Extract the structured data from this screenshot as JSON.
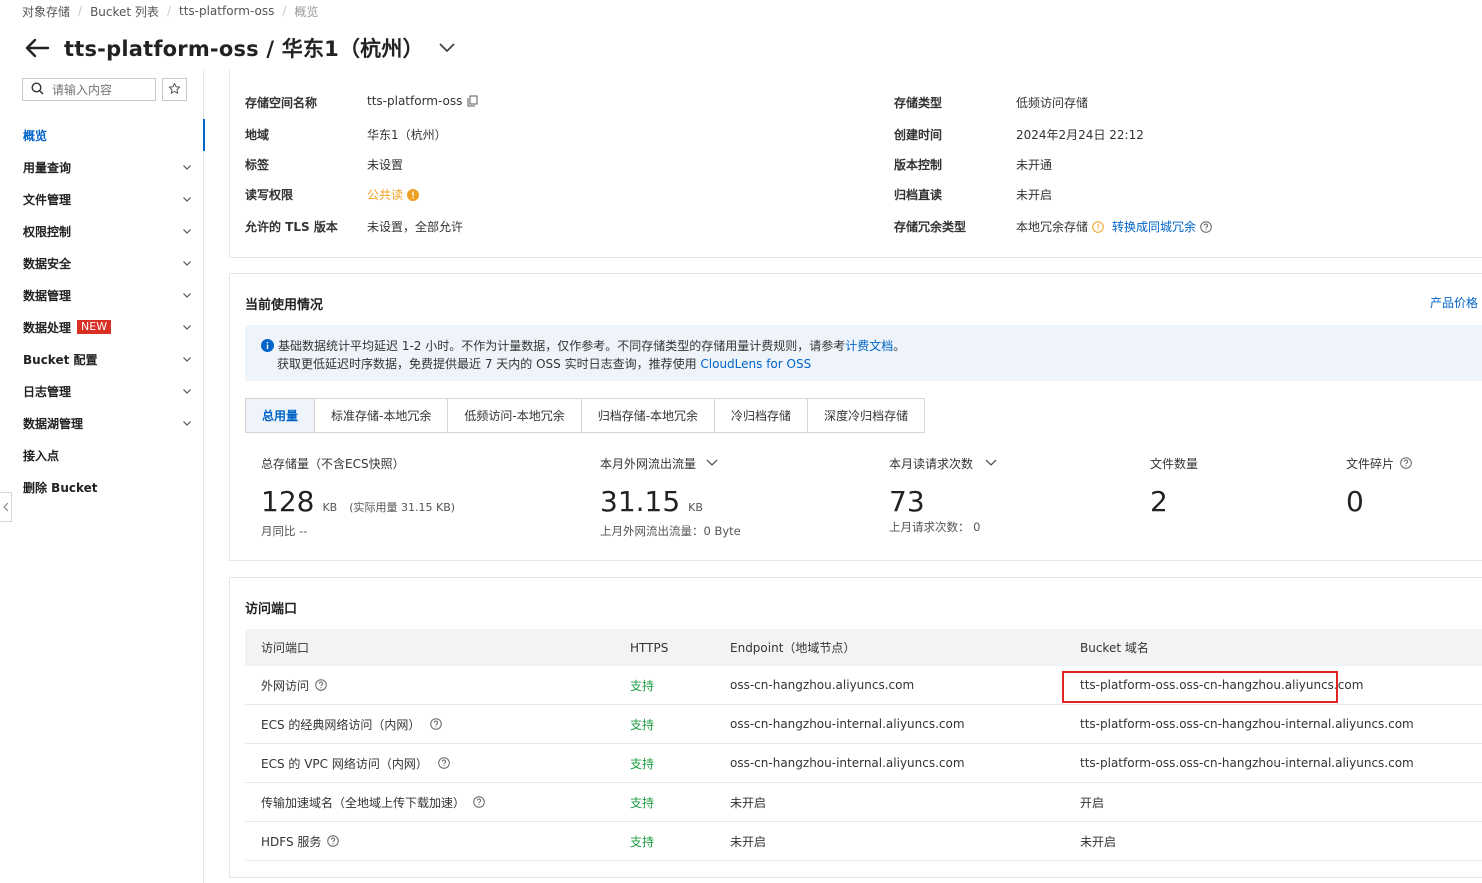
{
  "breadcrumb": [
    "对象存储",
    "Bucket 列表",
    "tts-platform-oss",
    "概览"
  ],
  "header": {
    "title": "tts-platform-oss / 华东1（杭州）"
  },
  "sidebar": {
    "search_placeholder": "请输入内容",
    "items": [
      {
        "label": "概览",
        "active": true
      },
      {
        "label": "用量查询"
      },
      {
        "label": "文件管理"
      },
      {
        "label": "权限控制"
      },
      {
        "label": "数据安全"
      },
      {
        "label": "数据管理"
      },
      {
        "label": "数据处理",
        "badge": "NEW"
      },
      {
        "label": "Bucket 配置"
      },
      {
        "label": "日志管理"
      },
      {
        "label": "数据湖管理"
      },
      {
        "label": "接入点"
      },
      {
        "label": "删除 Bucket"
      }
    ]
  },
  "info": {
    "bucket_name_label": "存储空间名称",
    "bucket_name": "tts-platform-oss",
    "region_label": "地域",
    "region": "华东1（杭州）",
    "tags_label": "标签",
    "tags": "未设置",
    "acl_label": "读写权限",
    "acl": "公共读",
    "tls_label": "允许的 TLS 版本",
    "tls": "未设置，全部允许",
    "storage_class_label": "存储类型",
    "storage_class": "低频访问存储",
    "created_label": "创建时间",
    "created": "2024年2月24日 22:12",
    "versioning_label": "版本控制",
    "versioning": "未开通",
    "archive_label": "归档直读",
    "archive": "未开启",
    "redundancy_label": "存储冗余类型",
    "redundancy": "本地冗余存储",
    "redundancy_link": "转换成同城冗余"
  },
  "usage": {
    "title": "当前使用情况",
    "price_link": "产品价格",
    "notice_line1_a": "基础数据统计平均延迟 1-2 小时。不作为计量数据，仅作参考。不同存储类型的存储用量计费规则，请参考",
    "notice_link": "计费文档",
    "notice_line1_b": "。",
    "notice_line2_a": "获取更低延迟时序数据，免费提供最近 7 天内的 OSS 实时日志查询，推荐使用 ",
    "notice_line2_link": "CloudLens for OSS",
    "tabs": [
      "总用量",
      "标准存储-本地冗余",
      "低频访问-本地冗余",
      "归档存储-本地冗余",
      "冷归档存储",
      "深度冷归档存储"
    ],
    "metrics": {
      "storage_label": "总存储量（不含ECS快照）",
      "storage_value": "128",
      "storage_unit": "KB",
      "storage_extra": "(实际用量 31.15 KB)",
      "storage_sub": "月同比  --",
      "traffic_label": "本月外网流出流量",
      "traffic_value": "31.15",
      "traffic_unit": "KB",
      "traffic_sub": "上月外网流出流量：0 Byte",
      "requests_label": "本月读请求次数",
      "requests_value": "73",
      "requests_sub": "上月请求次数：  0",
      "files_label": "文件数量",
      "files_value": "2",
      "fragments_label": "文件碎片",
      "fragments_value": "0"
    }
  },
  "endpoints": {
    "title": "访问端口",
    "headers": [
      "访问端口",
      "HTTPS",
      "Endpoint（地域节点）",
      "Bucket 域名"
    ],
    "rows": [
      {
        "name": "外网访问",
        "https": "支持",
        "endpoint": "oss-cn-hangzhou.aliyuncs.com",
        "domain": "tts-platform-oss.oss-cn-hangzhou.aliyuncs.com"
      },
      {
        "name": "ECS 的经典网络访问（内网）",
        "https": "支持",
        "endpoint": "oss-cn-hangzhou-internal.aliyuncs.com",
        "domain": "tts-platform-oss.oss-cn-hangzhou-internal.aliyuncs.com"
      },
      {
        "name": "ECS 的 VPC 网络访问（内网）",
        "https": "支持",
        "endpoint": "oss-cn-hangzhou-internal.aliyuncs.com",
        "domain": "tts-platform-oss.oss-cn-hangzhou-internal.aliyuncs.com"
      },
      {
        "name": "传输加速域名（全地域上传下载加速）",
        "https": "支持",
        "endpoint": "未开启",
        "domain": "开启"
      },
      {
        "name": "HDFS 服务",
        "https": "支持",
        "endpoint": "未开启",
        "domain": "未开启"
      }
    ]
  },
  "colors": {
    "accent": "#0064c8",
    "success": "#1e9e43",
    "warning": "#f0a020",
    "danger": "#e02424",
    "badge": "#d93026"
  }
}
